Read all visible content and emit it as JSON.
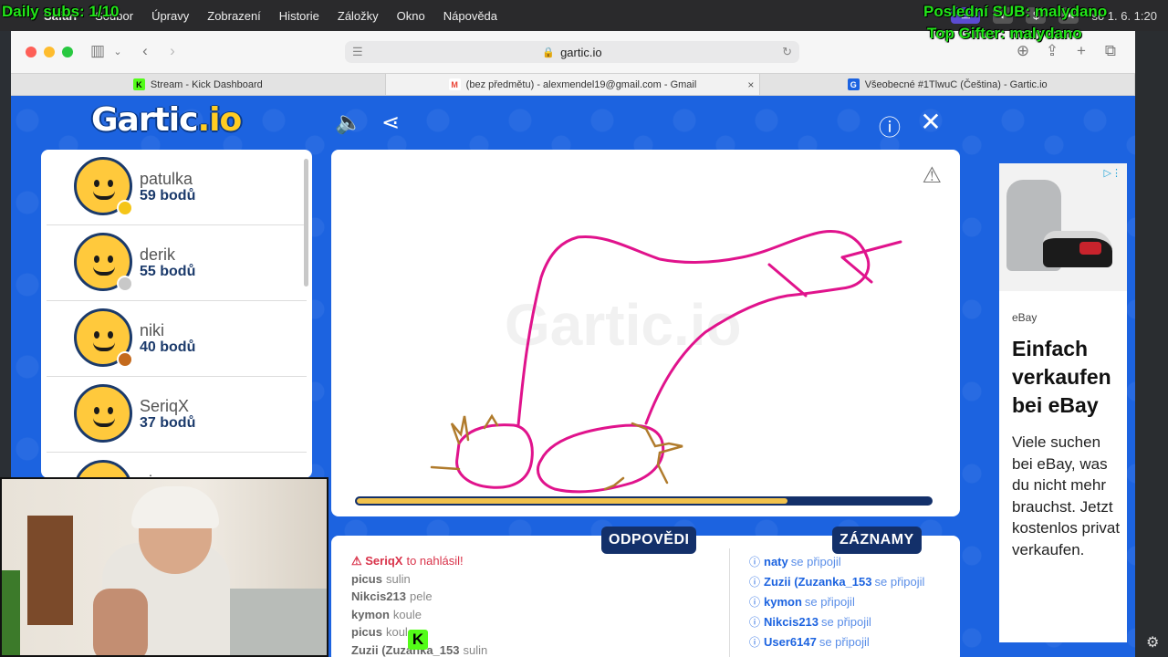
{
  "overlay": {
    "daily_subs": "Daily subs: 1/10",
    "last_sub": "Poslední SUB: malydano",
    "top_gifter": "Top Gifter: malydano"
  },
  "menubar": {
    "app": "Safari",
    "items": [
      "Soubor",
      "Úpravy",
      "Zobrazení",
      "Historie",
      "Záložky",
      "Okno",
      "Nápověda"
    ],
    "clock": "so 1. 6. 1:20"
  },
  "browser": {
    "url": "gartic.io",
    "tabs": [
      {
        "label": "Stream - Kick Dashboard",
        "favicon": "K",
        "color": "#53fc18"
      },
      {
        "label": "(bez předmětu) - alexmendel19@gmail.com - Gmail",
        "favicon": "M",
        "color": "#ea4335"
      },
      {
        "label": "Všeobecné #1TlwuC (Čeština) - Gartic.io",
        "favicon": "G",
        "color": "#1c63e0"
      }
    ]
  },
  "gartic": {
    "logo_main": "Gartic",
    "logo_suffix": ".io",
    "players": [
      {
        "name": "patulka",
        "score": "59 bodů",
        "dot_color": "#f5c518"
      },
      {
        "name": "derik",
        "score": "55 bodů",
        "dot_color": "#c8c8c8"
      },
      {
        "name": "niki",
        "score": "40 bodů",
        "dot_color": "#c46a1c"
      },
      {
        "name": "SeriqX",
        "score": "37 bodů",
        "dot_color": ""
      },
      {
        "name": "picus",
        "score": "",
        "dot_color": ""
      }
    ],
    "timer_fraction": 0.75,
    "answers_label": "ODPOVĚDI",
    "records_label": "ZÁZNAMY",
    "answers": [
      {
        "user": "⚠ SeriqX",
        "text": "to nahlásil!",
        "warn": true
      },
      {
        "user": "picus",
        "text": "sulin"
      },
      {
        "user": "Nikcis213",
        "text": "pele"
      },
      {
        "user": "kymon",
        "text": "koule"
      },
      {
        "user": "picus",
        "text": "koule"
      },
      {
        "user": "Zuzii (Zuzanka_153",
        "text": "sulin"
      }
    ],
    "records": [
      {
        "user": "naty",
        "text": "se připojil"
      },
      {
        "user": "Zuzii (Zuzanka_153",
        "text": "se připojil"
      },
      {
        "user": "kymon",
        "text": "se připojil"
      },
      {
        "user": "Nikcis213",
        "text": "se připojil"
      },
      {
        "user": "User6147",
        "text": "se připojil"
      }
    ]
  },
  "ad": {
    "brand": "eBay",
    "title": "Einfach verkaufen bei eBay",
    "body": "Viele suchen bei eBay, was du nicht mehr brauchst. Jetzt kostenlos privat verkaufen."
  },
  "kick_badge": "K"
}
